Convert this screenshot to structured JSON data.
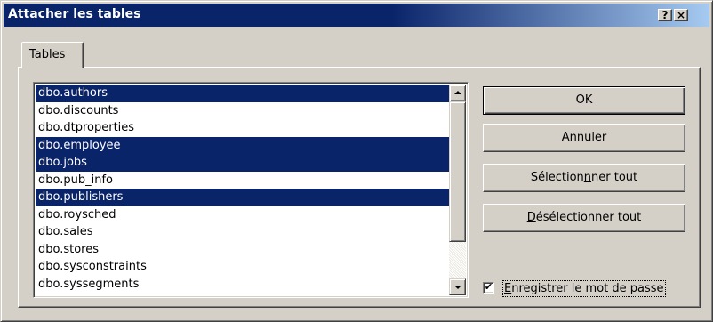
{
  "window": {
    "title": "Attacher les tables",
    "help_button": "?",
    "close_button": "×"
  },
  "tabs": [
    {
      "label": "Tables",
      "active": true
    }
  ],
  "tables_list": {
    "items": [
      {
        "label": "dbo.authors",
        "selected": true
      },
      {
        "label": "dbo.discounts",
        "selected": false
      },
      {
        "label": "dbo.dtproperties",
        "selected": false
      },
      {
        "label": "dbo.employee",
        "selected": true
      },
      {
        "label": "dbo.jobs",
        "selected": true
      },
      {
        "label": "dbo.pub_info",
        "selected": false
      },
      {
        "label": "dbo.publishers",
        "selected": true
      },
      {
        "label": "dbo.roysched",
        "selected": false
      },
      {
        "label": "dbo.sales",
        "selected": false
      },
      {
        "label": "dbo.stores",
        "selected": false
      },
      {
        "label": "dbo.sysconstraints",
        "selected": false
      },
      {
        "label": "dbo.syssegments",
        "selected": false
      }
    ]
  },
  "buttons": {
    "ok": "OK",
    "cancel": "Annuler",
    "select_all_pre": "Sélection",
    "select_all_mnemonic": "n",
    "select_all_post": "ner tout",
    "deselect_all_mnemonic": "D",
    "deselect_all_post": "ésélectionner tout"
  },
  "save_password": {
    "mnemonic": "E",
    "label_post": "nregistrer le mot de passe",
    "checked": true,
    "check_glyph": "✔"
  },
  "colors": {
    "selection": "#0a246a",
    "face": "#d4d0c8"
  }
}
